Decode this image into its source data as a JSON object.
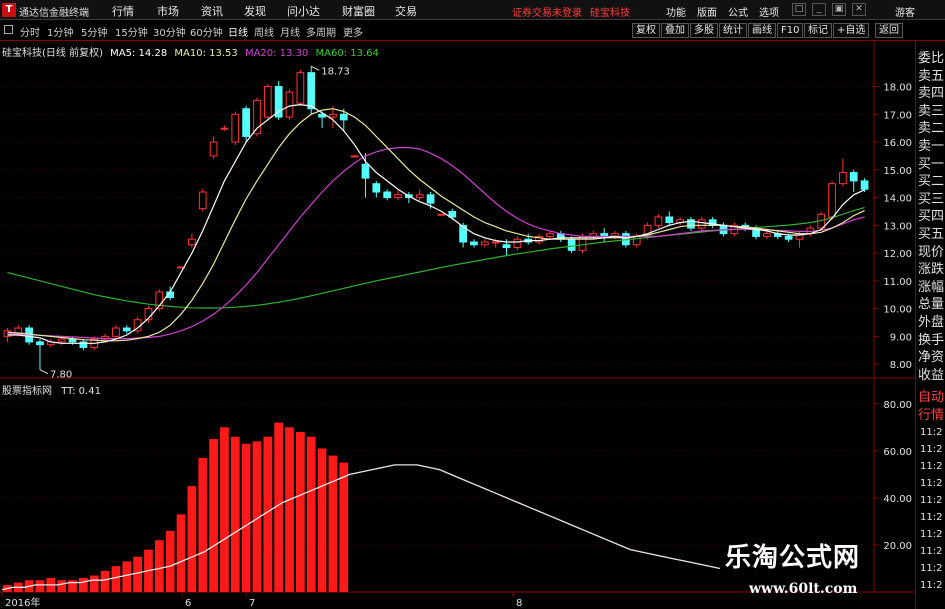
{
  "app": {
    "logo": "T",
    "title": "通达信金融终端"
  },
  "menu": [
    "行情",
    "市场",
    "资讯",
    "发现",
    "问小达",
    "财富圈",
    "交易"
  ],
  "status": {
    "trade": "证券交易未登录",
    "stock": "硅宝科技"
  },
  "right_menu": [
    "功能",
    "版面",
    "公式",
    "选项"
  ],
  "window_buttons": [
    "□",
    "_",
    "▣",
    "✕"
  ],
  "guest": "游客",
  "periods": [
    "分时",
    "1分钟",
    "5分钟",
    "15分钟",
    "30分钟",
    "60分钟",
    "日线",
    "周线",
    "月线",
    "多周期",
    "更多"
  ],
  "active_period": "日线",
  "toolbar_buttons": [
    "复权",
    "叠加",
    "多股",
    "统计",
    "画线",
    "F10",
    "标记",
    "+自选",
    "返回"
  ],
  "main_header": {
    "stock": "硅宝科技(日线 前复权)",
    "ma5": "MA5: 14.28",
    "ma10": "MA10: 13.53",
    "ma20": "MA20: 13.30",
    "ma60": "MA60: 13.64"
  },
  "sub_header": {
    "indicator": "股票指标网",
    "value": "TT: 0.41"
  },
  "annotations": {
    "high": "18.73",
    "low": "7.80"
  },
  "y_axis_main": [
    "18.00",
    "17.00",
    "16.00",
    "15.00",
    "14.00",
    "13.00",
    "12.00",
    "11.00",
    "10.00",
    "9.00",
    "8.00"
  ],
  "y_axis_sub": [
    "80.00",
    "60.00",
    "40.00",
    "20.00"
  ],
  "x_axis": [
    "2016年",
    "6",
    "7",
    "8"
  ],
  "side_labels": [
    "委比",
    "卖五",
    "卖四",
    "卖三",
    "卖二",
    "卖一",
    "买一",
    "买二",
    "买三",
    "买四",
    "买五",
    "现价",
    "涨跌",
    "涨幅",
    "总量",
    "外盘",
    "换手",
    "净资",
    "收益"
  ],
  "side_labels2": [
    "自动",
    "行情"
  ],
  "side_times": [
    "11:2",
    "11:2",
    "11:2",
    "11:2",
    "11:2",
    "11:2",
    "11:2",
    "11:2",
    "11:2",
    "11:2"
  ],
  "colors": {
    "up": "#ff3333",
    "down": "#54ffff",
    "ma5": "#ffffff",
    "ma10": "#e8e8a0",
    "ma20": "#d040d0",
    "ma60": "#30b030",
    "grid": "#8a0000",
    "bar": "#ff1a1a"
  },
  "watermark": {
    "line1": "乐淘公式网",
    "line2": "www.60lt.com"
  },
  "chart_data": {
    "type": "candlestick",
    "ylim": [
      7.5,
      19.1
    ],
    "candles": [
      [
        9.0,
        9.2,
        8.8,
        9.3
      ],
      [
        9.1,
        9.3,
        9.0,
        9.4
      ],
      [
        9.3,
        8.8,
        8.7,
        9.4
      ],
      [
        8.8,
        8.7,
        7.8,
        8.9
      ],
      [
        8.7,
        8.8,
        8.6,
        8.9
      ],
      [
        8.8,
        8.9,
        8.7,
        9.0
      ],
      [
        8.9,
        8.8,
        8.7,
        9.0
      ],
      [
        8.8,
        8.6,
        8.5,
        8.9
      ],
      [
        8.6,
        8.9,
        8.5,
        9.0
      ],
      [
        8.9,
        9.0,
        8.8,
        9.1
      ],
      [
        9.0,
        9.3,
        8.9,
        9.4
      ],
      [
        9.3,
        9.2,
        9.1,
        9.4
      ],
      [
        9.2,
        9.6,
        9.1,
        9.7
      ],
      [
        9.6,
        10.0,
        9.5,
        10.1
      ],
      [
        10.0,
        10.6,
        9.9,
        10.7
      ],
      [
        10.6,
        10.4,
        10.3,
        10.8
      ],
      [
        11.5,
        11.5,
        11.5,
        11.5
      ],
      [
        12.3,
        12.5,
        12.2,
        12.7
      ],
      [
        13.6,
        14.2,
        13.5,
        14.3
      ],
      [
        15.5,
        16.0,
        15.4,
        16.2
      ],
      [
        16.5,
        16.5,
        16.4,
        16.6
      ],
      [
        16.0,
        17.0,
        15.9,
        17.1
      ],
      [
        17.2,
        16.2,
        16.0,
        17.3
      ],
      [
        16.3,
        17.5,
        16.2,
        17.6
      ],
      [
        16.9,
        18.0,
        16.8,
        18.1
      ],
      [
        18.0,
        16.9,
        16.8,
        18.2
      ],
      [
        16.9,
        17.8,
        16.8,
        17.9
      ],
      [
        17.4,
        18.5,
        17.3,
        18.6
      ],
      [
        18.5,
        17.2,
        17.0,
        18.73
      ],
      [
        17.0,
        16.9,
        16.5,
        17.1
      ],
      [
        16.9,
        17.0,
        16.5,
        17.3
      ],
      [
        17.0,
        16.8,
        16.4,
        17.2
      ],
      [
        15.5,
        15.5,
        15.5,
        15.5
      ],
      [
        15.2,
        14.7,
        14.0,
        15.6
      ],
      [
        14.5,
        14.2,
        14.0,
        14.6
      ],
      [
        14.2,
        14.0,
        13.9,
        14.3
      ],
      [
        14.0,
        14.1,
        13.9,
        14.3
      ],
      [
        14.1,
        14.0,
        13.8,
        14.2
      ],
      [
        14.0,
        14.1,
        13.9,
        14.3
      ],
      [
        14.1,
        13.8,
        13.6,
        14.2
      ],
      [
        13.4,
        13.4,
        13.4,
        13.4
      ],
      [
        13.5,
        13.3,
        13.2,
        13.6
      ],
      [
        13.0,
        12.4,
        12.2,
        13.1
      ],
      [
        12.4,
        12.3,
        12.2,
        12.5
      ],
      [
        12.3,
        12.4,
        12.2,
        12.5
      ],
      [
        12.4,
        12.4,
        12.2,
        12.5
      ],
      [
        12.3,
        12.2,
        11.9,
        12.5
      ],
      [
        12.2,
        12.5,
        12.1,
        12.6
      ],
      [
        12.5,
        12.4,
        12.3,
        12.7
      ],
      [
        12.4,
        12.6,
        12.3,
        12.7
      ],
      [
        12.6,
        12.7,
        12.5,
        12.8
      ],
      [
        12.7,
        12.5,
        12.4,
        12.8
      ],
      [
        12.5,
        12.1,
        12.0,
        12.6
      ],
      [
        12.1,
        12.6,
        12.0,
        12.7
      ],
      [
        12.6,
        12.7,
        12.5,
        12.8
      ],
      [
        12.7,
        12.6,
        12.4,
        12.9
      ],
      [
        12.6,
        12.7,
        12.5,
        12.8
      ],
      [
        12.7,
        12.3,
        12.2,
        12.8
      ],
      [
        12.3,
        12.6,
        12.2,
        12.7
      ],
      [
        12.6,
        13.0,
        12.5,
        13.1
      ],
      [
        13.0,
        13.3,
        12.9,
        13.4
      ],
      [
        13.3,
        13.1,
        13.0,
        13.5
      ],
      [
        13.1,
        13.2,
        13.0,
        13.3
      ],
      [
        13.2,
        12.9,
        12.8,
        13.3
      ],
      [
        12.9,
        13.2,
        12.8,
        13.3
      ],
      [
        13.2,
        13.0,
        12.9,
        13.3
      ],
      [
        13.0,
        12.7,
        12.6,
        13.1
      ],
      [
        12.7,
        13.0,
        12.6,
        13.1
      ],
      [
        13.0,
        12.9,
        12.8,
        13.1
      ],
      [
        12.9,
        12.6,
        12.5,
        13.0
      ],
      [
        12.6,
        12.7,
        12.5,
        12.8
      ],
      [
        12.7,
        12.6,
        12.5,
        12.8
      ],
      [
        12.6,
        12.5,
        12.4,
        12.7
      ],
      [
        12.5,
        12.7,
        12.2,
        12.8
      ],
      [
        12.7,
        12.9,
        12.6,
        13.0
      ],
      [
        12.9,
        13.4,
        12.8,
        13.5
      ],
      [
        13.3,
        14.5,
        13.2,
        14.6
      ],
      [
        14.5,
        14.9,
        14.4,
        15.4
      ],
      [
        14.9,
        14.6,
        14.2,
        15.0
      ],
      [
        14.6,
        14.3,
        14.2,
        14.7
      ]
    ],
    "ma5": [
      9.05,
      9.05,
      9.0,
      8.95,
      8.8,
      8.75,
      8.75,
      8.75,
      8.75,
      8.8,
      8.9,
      9.05,
      9.3,
      9.65,
      10.1,
      10.6,
      11.3,
      12.0,
      12.8,
      13.7,
      14.6,
      15.3,
      16.0,
      16.5,
      16.8,
      17.1,
      17.3,
      17.35,
      17.3,
      17.05,
      16.8,
      16.4,
      15.9,
      15.3,
      14.9,
      14.6,
      14.3,
      14.05,
      13.85,
      13.7,
      13.5,
      13.25,
      12.95,
      12.7,
      12.55,
      12.45,
      12.4,
      12.4,
      12.45,
      12.45,
      12.5,
      12.55,
      12.55,
      12.55,
      12.55,
      12.55,
      12.6,
      12.55,
      12.6,
      12.7,
      12.85,
      13.0,
      13.1,
      13.15,
      13.1,
      13.05,
      13.0,
      12.95,
      12.9,
      12.85,
      12.8,
      12.7,
      12.65,
      12.65,
      12.7,
      12.85,
      13.25,
      13.75,
      14.1,
      14.28
    ],
    "ma10": [
      9.15,
      9.12,
      9.08,
      9.04,
      9.0,
      8.96,
      8.92,
      8.88,
      8.86,
      8.84,
      8.84,
      8.86,
      8.92,
      9.0,
      9.15,
      9.4,
      9.8,
      10.3,
      10.9,
      11.6,
      12.4,
      13.2,
      13.95,
      14.6,
      15.2,
      15.8,
      16.3,
      16.7,
      17.0,
      17.15,
      17.2,
      17.1,
      16.9,
      16.6,
      16.2,
      15.8,
      15.4,
      15.0,
      14.65,
      14.35,
      14.05,
      13.8,
      13.55,
      13.3,
      13.1,
      12.95,
      12.8,
      12.7,
      12.6,
      12.55,
      12.5,
      12.5,
      12.5,
      12.5,
      12.5,
      12.55,
      12.55,
      12.55,
      12.6,
      12.65,
      12.75,
      12.85,
      12.95,
      13.0,
      13.0,
      13.0,
      13.0,
      12.95,
      12.95,
      12.9,
      12.85,
      12.8,
      12.75,
      12.7,
      12.7,
      12.75,
      12.9,
      13.1,
      13.35,
      13.53
    ],
    "ma20": [
      9.1,
      9.08,
      9.06,
      9.04,
      9.02,
      9.0,
      8.98,
      8.96,
      8.94,
      8.92,
      8.92,
      8.92,
      8.94,
      8.96,
      9.0,
      9.08,
      9.2,
      9.35,
      9.55,
      9.8,
      10.1,
      10.45,
      10.85,
      11.3,
      11.8,
      12.3,
      12.8,
      13.3,
      13.75,
      14.2,
      14.6,
      14.95,
      15.25,
      15.5,
      15.65,
      15.75,
      15.8,
      15.8,
      15.75,
      15.6,
      15.4,
      15.15,
      14.85,
      14.5,
      14.15,
      13.8,
      13.5,
      13.25,
      13.05,
      12.9,
      12.8,
      12.7,
      12.65,
      12.6,
      12.6,
      12.6,
      12.6,
      12.6,
      12.6,
      12.6,
      12.6,
      12.65,
      12.7,
      12.75,
      12.8,
      12.82,
      12.84,
      12.85,
      12.85,
      12.85,
      12.84,
      12.82,
      12.8,
      12.78,
      12.78,
      12.82,
      12.9,
      13.05,
      13.2,
      13.3
    ],
    "ma60": [
      11.3,
      11.2,
      11.1,
      11.0,
      10.9,
      10.8,
      10.7,
      10.6,
      10.5,
      10.42,
      10.35,
      10.28,
      10.22,
      10.16,
      10.12,
      10.08,
      10.05,
      10.03,
      10.02,
      10.02,
      10.03,
      10.05,
      10.08,
      10.12,
      10.17,
      10.23,
      10.3,
      10.38,
      10.46,
      10.55,
      10.64,
      10.73,
      10.82,
      10.91,
      11.0,
      11.08,
      11.16,
      11.24,
      11.32,
      11.4,
      11.48,
      11.56,
      11.63,
      11.7,
      11.77,
      11.84,
      11.91,
      11.97,
      12.03,
      12.09,
      12.15,
      12.2,
      12.25,
      12.3,
      12.35,
      12.4,
      12.44,
      12.48,
      12.52,
      12.56,
      12.6,
      12.64,
      12.68,
      12.72,
      12.76,
      12.8,
      12.83,
      12.86,
      12.89,
      12.92,
      12.95,
      12.98,
      13.01,
      13.05,
      13.1,
      13.17,
      13.27,
      13.4,
      13.53,
      13.64
    ],
    "sub_ylim": [
      0,
      85
    ],
    "bars": [
      3,
      4,
      5,
      5,
      6,
      5,
      5,
      6,
      7,
      9,
      11,
      13,
      15,
      18,
      22,
      26,
      33,
      45,
      57,
      65,
      70,
      66,
      63,
      64,
      66,
      72,
      70,
      68,
      66,
      61,
      58,
      55
    ],
    "tt_line": [
      1,
      2,
      2,
      3,
      3,
      3,
      4,
      4,
      5,
      5,
      6,
      7,
      8,
      9,
      10,
      11,
      13,
      15,
      17,
      20,
      23,
      26,
      29,
      32,
      35,
      38,
      40,
      42,
      44,
      46,
      48,
      50,
      51,
      52,
      53,
      54,
      54,
      54,
      53,
      52,
      50,
      48,
      46,
      44,
      42,
      40,
      38,
      36,
      34,
      32,
      30,
      28,
      26,
      24,
      22,
      20,
      18,
      17,
      16,
      15,
      14,
      13,
      12,
      11,
      10
    ]
  }
}
